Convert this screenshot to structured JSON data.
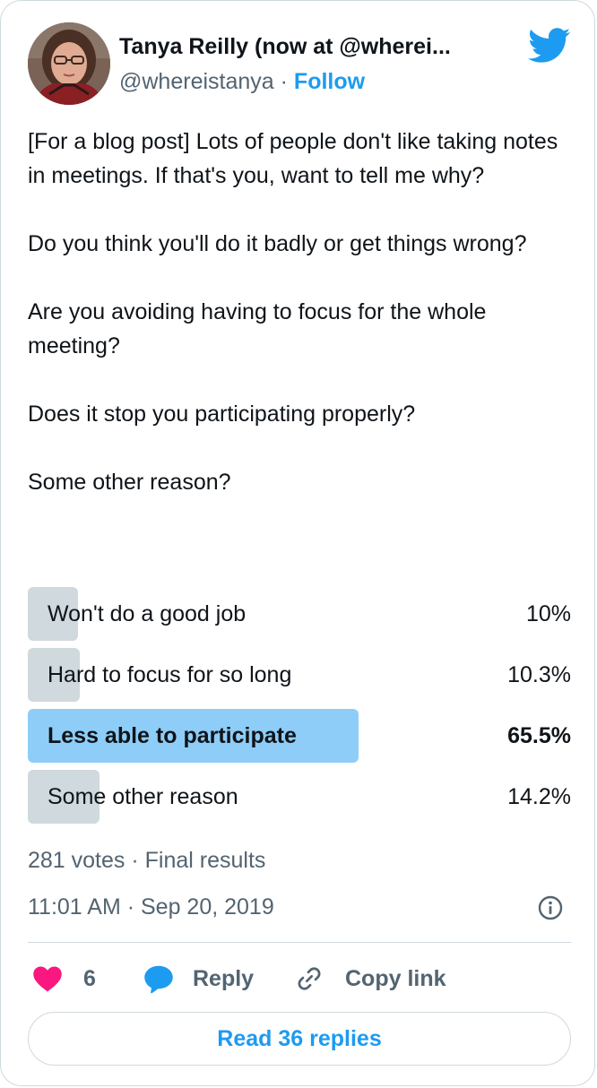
{
  "author": {
    "name": "Tanya Reilly (now at @wherei...",
    "handle": "@whereistanya",
    "separator": "·",
    "follow_label": "Follow"
  },
  "tweet": {
    "paragraphs": [
      "[For a blog post] Lots of people don't like taking notes in meetings. If that's you, want to tell me why?",
      "Do you think you'll do it badly or get things wrong?",
      "Are you avoiding having to focus for the whole meeting?",
      "Does it stop you participating properly?",
      "Some other reason?"
    ]
  },
  "poll": {
    "options": [
      {
        "label": "Won't do a good job",
        "percent_text": "10%",
        "percent": 10,
        "winner": false
      },
      {
        "label": "Hard to focus for so long",
        "percent_text": "10.3%",
        "percent": 10.3,
        "winner": false
      },
      {
        "label": "Less able to participate",
        "percent_text": "65.5%",
        "percent": 65.5,
        "winner": true
      },
      {
        "label": "Some other reason",
        "percent_text": "14.2%",
        "percent": 14.2,
        "winner": false
      }
    ],
    "meta": "281 votes · Final results"
  },
  "timestamp": "11:01 AM · Sep 20, 2019",
  "actions": {
    "like_count": "6",
    "reply_label": "Reply",
    "copy_label": "Copy link"
  },
  "read_replies_label": "Read 36 replies",
  "colors": {
    "accent": "#1d9bf0",
    "like": "#f91880",
    "poll_bar": "#cfd9de",
    "poll_bar_winner": "#8ecdf8",
    "secondary_text": "#536471"
  },
  "icons": {
    "logo": "twitter-bird-icon",
    "info": "info-circle-icon",
    "like": "heart-icon",
    "reply": "speech-bubble-icon",
    "copy": "link-icon"
  }
}
